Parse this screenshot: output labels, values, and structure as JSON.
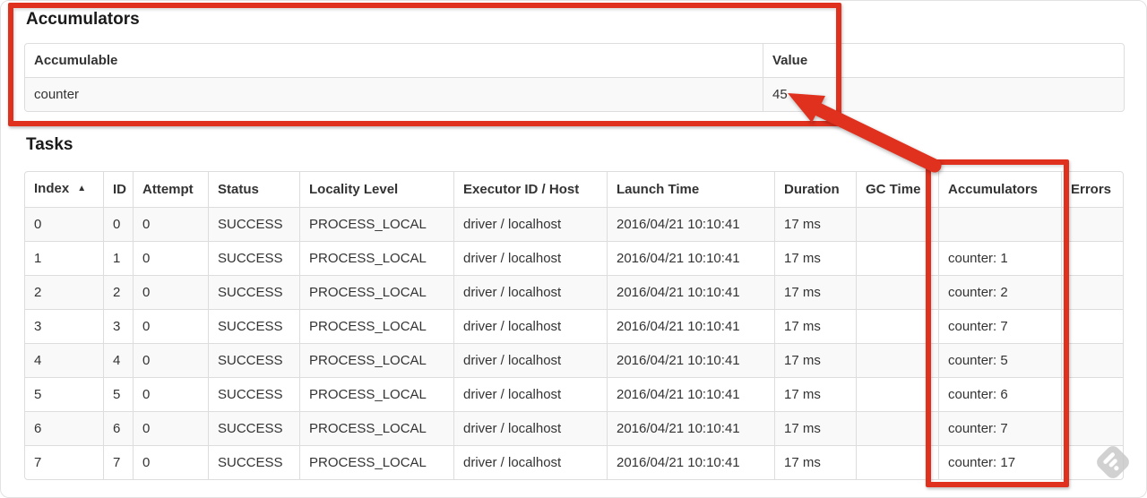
{
  "accumulators_section": {
    "title": "Accumulators",
    "table": {
      "headers": [
        "Accumulable",
        "Value"
      ],
      "rows": [
        {
          "accumulable": "counter",
          "value": "45"
        }
      ]
    }
  },
  "tasks_section": {
    "title": "Tasks",
    "table": {
      "headers": [
        "Index",
        "ID",
        "Attempt",
        "Status",
        "Locality Level",
        "Executor ID / Host",
        "Launch Time",
        "Duration",
        "GC Time",
        "Accumulators",
        "Errors"
      ],
      "sort": {
        "column": "Index",
        "direction": "ascending",
        "glyph": "▲"
      },
      "rows": [
        {
          "index": "0",
          "id": "0",
          "attempt": "0",
          "status": "SUCCESS",
          "locality": "PROCESS_LOCAL",
          "executor": "driver / localhost",
          "launch_time": "2016/04/21 10:10:41",
          "duration": "17 ms",
          "gc_time": "",
          "accumulators": "",
          "errors": ""
        },
        {
          "index": "1",
          "id": "1",
          "attempt": "0",
          "status": "SUCCESS",
          "locality": "PROCESS_LOCAL",
          "executor": "driver / localhost",
          "launch_time": "2016/04/21 10:10:41",
          "duration": "17 ms",
          "gc_time": "",
          "accumulators": "counter: 1",
          "errors": ""
        },
        {
          "index": "2",
          "id": "2",
          "attempt": "0",
          "status": "SUCCESS",
          "locality": "PROCESS_LOCAL",
          "executor": "driver / localhost",
          "launch_time": "2016/04/21 10:10:41",
          "duration": "17 ms",
          "gc_time": "",
          "accumulators": "counter: 2",
          "errors": ""
        },
        {
          "index": "3",
          "id": "3",
          "attempt": "0",
          "status": "SUCCESS",
          "locality": "PROCESS_LOCAL",
          "executor": "driver / localhost",
          "launch_time": "2016/04/21 10:10:41",
          "duration": "17 ms",
          "gc_time": "",
          "accumulators": "counter: 7",
          "errors": ""
        },
        {
          "index": "4",
          "id": "4",
          "attempt": "0",
          "status": "SUCCESS",
          "locality": "PROCESS_LOCAL",
          "executor": "driver / localhost",
          "launch_time": "2016/04/21 10:10:41",
          "duration": "17 ms",
          "gc_time": "",
          "accumulators": "counter: 5",
          "errors": ""
        },
        {
          "index": "5",
          "id": "5",
          "attempt": "0",
          "status": "SUCCESS",
          "locality": "PROCESS_LOCAL",
          "executor": "driver / localhost",
          "launch_time": "2016/04/21 10:10:41",
          "duration": "17 ms",
          "gc_time": "",
          "accumulators": "counter: 6",
          "errors": ""
        },
        {
          "index": "6",
          "id": "6",
          "attempt": "0",
          "status": "SUCCESS",
          "locality": "PROCESS_LOCAL",
          "executor": "driver / localhost",
          "launch_time": "2016/04/21 10:10:41",
          "duration": "17 ms",
          "gc_time": "",
          "accumulators": "counter: 7",
          "errors": ""
        },
        {
          "index": "7",
          "id": "7",
          "attempt": "0",
          "status": "SUCCESS",
          "locality": "PROCESS_LOCAL",
          "executor": "driver / localhost",
          "launch_time": "2016/04/21 10:10:41",
          "duration": "17 ms",
          "gc_time": "",
          "accumulators": "counter: 17",
          "errors": ""
        }
      ]
    }
  },
  "annotations": {
    "color": "#e0301e"
  },
  "watermark": {
    "icon": "skitch-logo"
  }
}
